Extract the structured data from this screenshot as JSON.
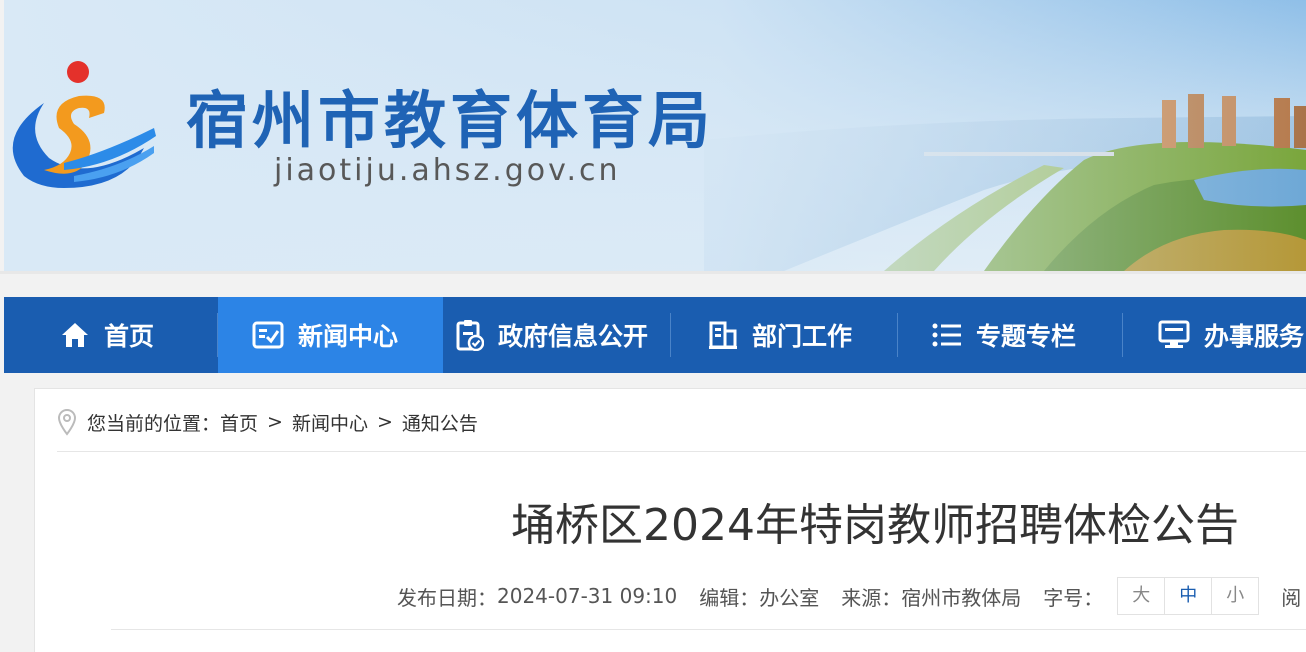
{
  "banner": {
    "site_title": "宿州市教育体育局",
    "domain": "jiaotiju.ahsz.gov.cn",
    "colors": {
      "title": "#1f63b5",
      "emblem_orange": "#f39a1e",
      "emblem_red": "#e4312b",
      "emblem_blue": "#1f6bd0"
    }
  },
  "nav": {
    "items": [
      {
        "label": "首页",
        "icon": "home-icon"
      },
      {
        "label": "新闻中心",
        "icon": "news-icon",
        "active": true
      },
      {
        "label": "政府信息公开",
        "icon": "clipboard-check-icon"
      },
      {
        "label": "部门工作",
        "icon": "building-icon"
      },
      {
        "label": "专题专栏",
        "icon": "list-icon"
      },
      {
        "label": "办事服务",
        "icon": "monitor-icon"
      }
    ],
    "colors": {
      "bar": "#1a5db0",
      "active": "#2c84e6"
    }
  },
  "breadcrumb": {
    "prefix": "您当前的位置：",
    "items": [
      "首页",
      "新闻中心",
      "通知公告"
    ],
    "separator": ">"
  },
  "article": {
    "title": "埇桥区2024年特岗教师招聘体检公告",
    "meta": {
      "publish_label": "发布日期：",
      "publish_value": "2024-07-31 09:10",
      "editor_label": "编辑：",
      "editor_value": "办公室",
      "source_label": "来源：",
      "source_value": "宿州市教体局",
      "fontsize_label": "字号：",
      "fontsize_options": [
        "大",
        "中",
        "小"
      ],
      "fontsize_selected": "中",
      "read_label": "阅"
    }
  }
}
